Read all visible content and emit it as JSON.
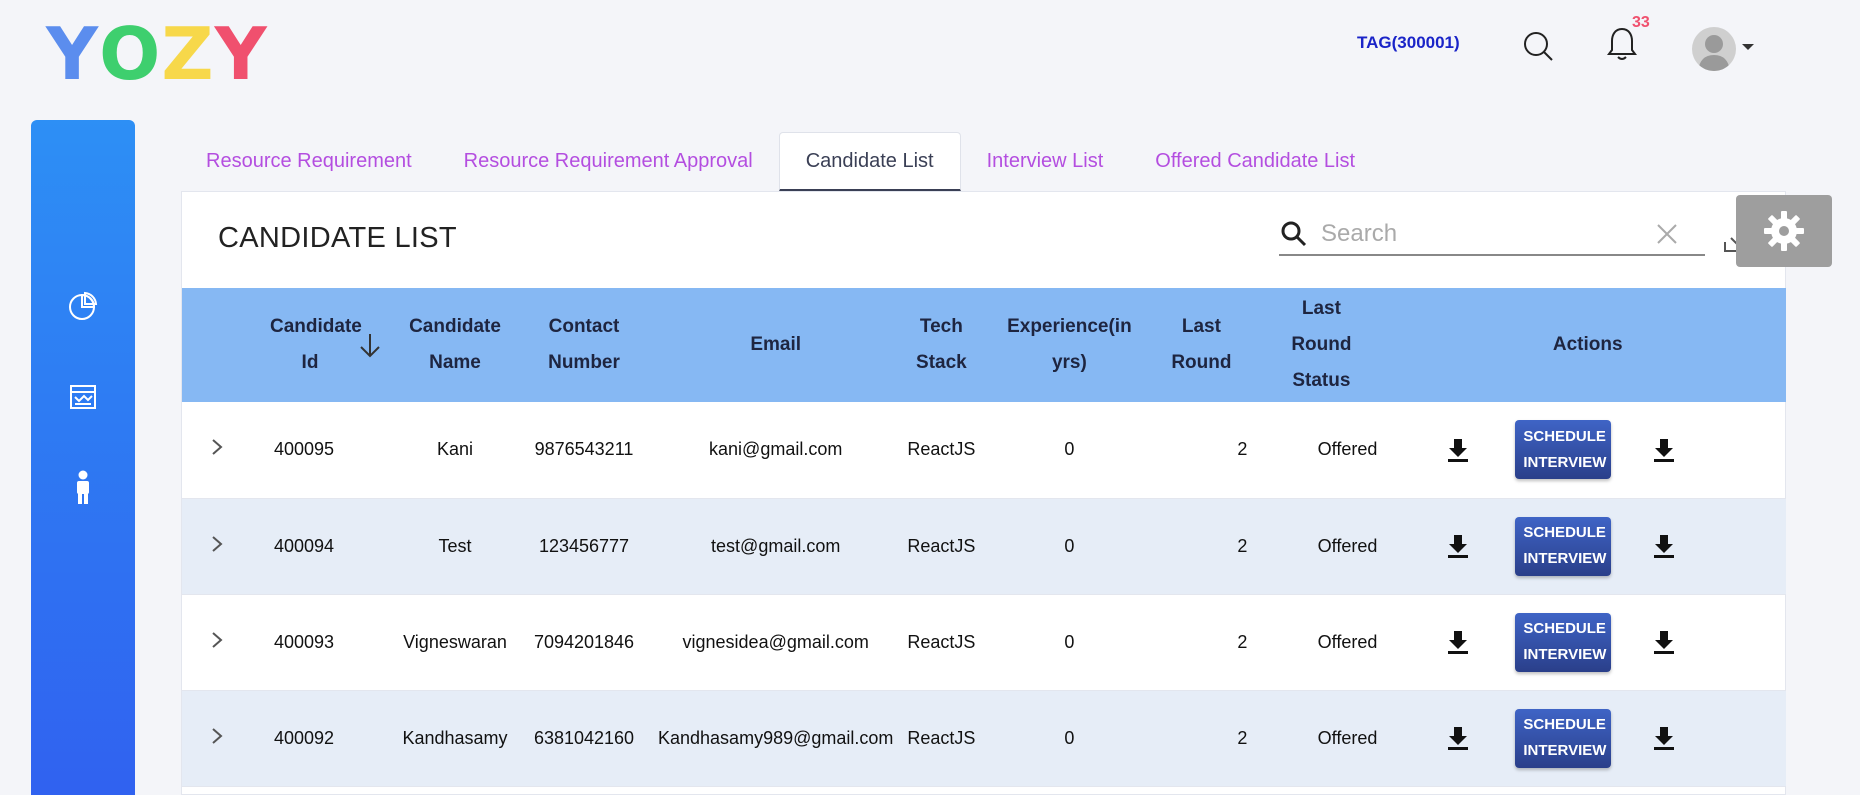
{
  "brand": {
    "letters": [
      "Y",
      "O",
      "Z",
      "Y"
    ]
  },
  "header": {
    "tag": "TAG(300001)",
    "notification_count": "33"
  },
  "tabs": [
    {
      "label": "Resource Requirement",
      "active": false
    },
    {
      "label": "Resource Requirement Approval",
      "active": false
    },
    {
      "label": "Candidate List",
      "active": true
    },
    {
      "label": "Interview List",
      "active": false
    },
    {
      "label": "Offered Candidate List",
      "active": false
    }
  ],
  "panel": {
    "title": "CANDIDATE LIST",
    "search": {
      "placeholder": "Search",
      "value": ""
    }
  },
  "table": {
    "columns": [
      "Candidate Id",
      "Candidate Name",
      "Contact Number",
      "Email",
      "Tech Stack",
      "Experience(in yrs)",
      "Last Round",
      "Last Round Status",
      "Actions"
    ],
    "action_label": "SCHEDULE INTERVIEW",
    "rows": [
      {
        "id": "400095",
        "name": "Kani",
        "contact": "9876543211",
        "email": "kani@gmail.com",
        "tech": "ReactJS",
        "experience": "0",
        "last_round": "2",
        "status": "Offered"
      },
      {
        "id": "400094",
        "name": "Test",
        "contact": "123456777",
        "email": "test@gmail.com",
        "tech": "ReactJS",
        "experience": "0",
        "last_round": "2",
        "status": "Offered"
      },
      {
        "id": "400093",
        "name": "Vigneswaran",
        "contact": "7094201846",
        "email": "vignesidea@gmail.com",
        "tech": "ReactJS",
        "experience": "0",
        "last_round": "2",
        "status": "Offered"
      },
      {
        "id": "400092",
        "name": "Kandhasamy",
        "contact": "6381042160",
        "email": "Kandhasamy989@gmail.com",
        "tech": "ReactJS",
        "experience": "0",
        "last_round": "2",
        "status": "Offered"
      }
    ]
  },
  "sidebar": {
    "items": [
      {
        "icon": "pie-chart-icon"
      },
      {
        "icon": "report-icon"
      },
      {
        "icon": "person-icon",
        "active": true
      }
    ]
  },
  "colors": {
    "accent": "#2d8ff5",
    "tab_text": "#b44ee0",
    "header_row": "#86b8f3",
    "button": "#2a3f8a"
  }
}
